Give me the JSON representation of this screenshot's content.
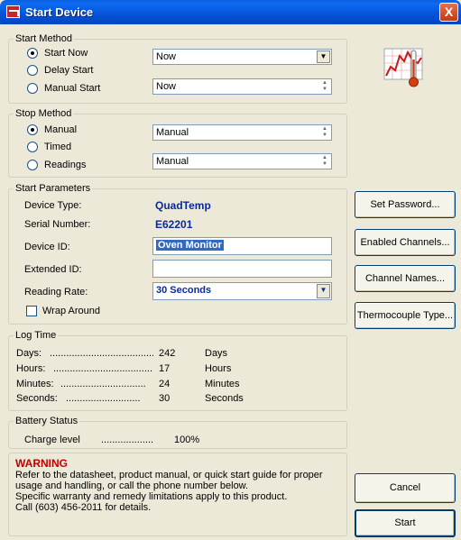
{
  "window": {
    "title": "Start Device",
    "close_glyph": "X"
  },
  "start_method": {
    "label": "Start Method",
    "options": [
      {
        "label": "Start Now",
        "selected": true
      },
      {
        "label": "Delay Start",
        "selected": false
      },
      {
        "label": "Manual Start",
        "selected": false
      }
    ],
    "combo1_value": "Now",
    "combo2_value": "Now"
  },
  "stop_method": {
    "label": "Stop Method",
    "options": [
      {
        "label": "Manual",
        "selected": true
      },
      {
        "label": "Timed",
        "selected": false
      },
      {
        "label": "Readings",
        "selected": false
      }
    ],
    "combo1_value": "Manual",
    "combo2_value": "Manual"
  },
  "start_parameters": {
    "label": "Start Parameters",
    "device_type_label": "Device Type:",
    "device_type_value": "QuadTemp",
    "serial_label": "Serial Number:",
    "serial_value": "E62201",
    "device_id_label": "Device ID:",
    "device_id_value": "Oven Monitor",
    "extended_id_label": "Extended ID:",
    "extended_id_value": "",
    "reading_rate_label": "Reading Rate:",
    "reading_rate_value": "30 Seconds",
    "wrap_around_label": "Wrap Around",
    "wrap_around_checked": false
  },
  "log_time": {
    "label": "Log Time",
    "rows": [
      {
        "label": "Days:",
        "dots": "......................................",
        "value": "242",
        "unit": "Days"
      },
      {
        "label": "Hours:",
        "dots": ".....................................",
        "value": "17",
        "unit": "Hours"
      },
      {
        "label": "Minutes:",
        "dots": "...............................",
        "value": "24",
        "unit": "Minutes"
      },
      {
        "label": "Seconds:",
        "dots": "...........................",
        "value": "30",
        "unit": "Seconds"
      }
    ]
  },
  "battery_status": {
    "label": "Battery Status",
    "charge_label": "Charge level",
    "charge_dots": "...................",
    "charge_value": "100%"
  },
  "warning": {
    "title": "WARNING",
    "lines": [
      "Refer to the datasheet, product manual, or quick start guide for proper",
      "usage and handling, or call the phone number below.",
      "Specific warranty and remedy limitations apply to this product.",
      "Call (603) 456-2011 for details."
    ]
  },
  "buttons": {
    "set_password": "Set Password...",
    "enabled_channels": "Enabled Channels...",
    "channel_names": "Channel Names...",
    "thermocouple_type": "Thermocouple Type...",
    "cancel": "Cancel",
    "start": "Start"
  },
  "icons": {
    "app_icon": "chart-thermometer-icon",
    "title_icon": "app-logo-icon",
    "dropdown": "chevron-down-icon",
    "spinner": "spinner-icon"
  }
}
